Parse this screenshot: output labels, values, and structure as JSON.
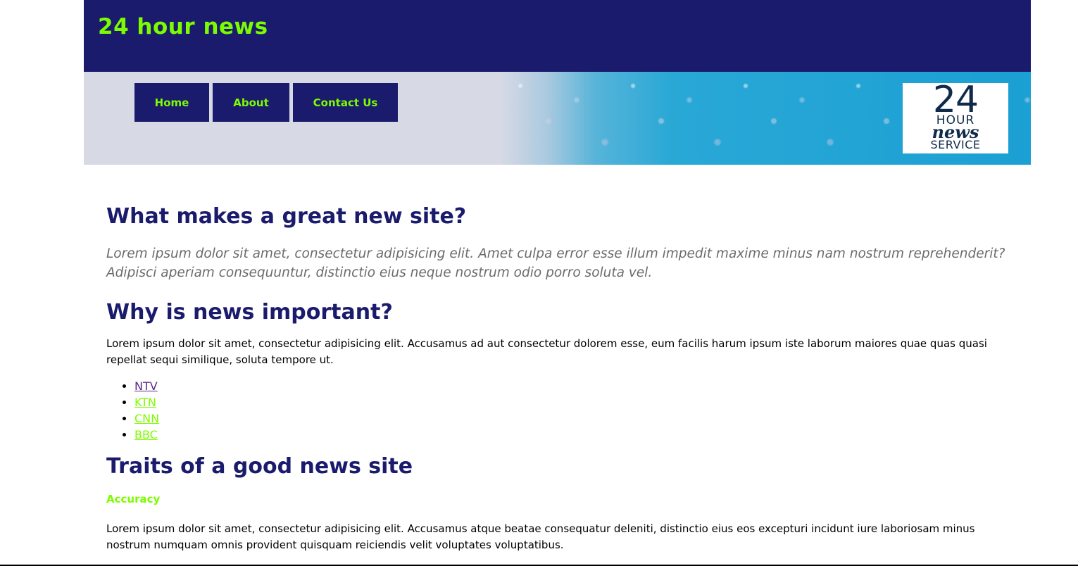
{
  "header": {
    "site_title": "24 hour news"
  },
  "nav": {
    "items": [
      {
        "label": "Home"
      },
      {
        "label": "About"
      },
      {
        "label": "Contact Us"
      }
    ]
  },
  "logo": {
    "line1": "24",
    "line2": "HOUR",
    "line3": "news",
    "line4": "SERVICE"
  },
  "main": {
    "section1": {
      "heading": "What makes a great new site?",
      "lead": "Lorem ipsum dolor sit amet, consectetur adipisicing elit. Amet culpa error esse illum impedit maxime minus nam nostrum reprehenderit? Adipisci aperiam consequuntur, distinctio eius neque nostrum odio porro soluta vel."
    },
    "section2": {
      "heading": "Why is news important?",
      "body": "Lorem ipsum dolor sit amet, consectetur adipisicing elit. Accusamus ad aut consectetur dolorem esse, eum facilis harum ipsum iste laborum maiores quae quas quasi repellat sequi similique, soluta tempore ut.",
      "links": [
        "NTV",
        "KTN",
        "CNN",
        "BBC"
      ]
    },
    "section3": {
      "heading": "Traits of a good news site",
      "subheading": "Accuracy",
      "body": "Lorem ipsum dolor sit amet, consectetur adipisicing elit. Accusamus atque beatae consequatur deleniti, distinctio eius eos excepturi incidunt iure laboriosam minus nostrum numquam omnis provident quisquam reiciendis velit voluptates voluptatibus."
    }
  },
  "colors": {
    "navy": "#1b1b6e",
    "lime": "#7cfc00",
    "visited_link": "#5b2a86",
    "lead_gray": "#6b6b6b"
  }
}
